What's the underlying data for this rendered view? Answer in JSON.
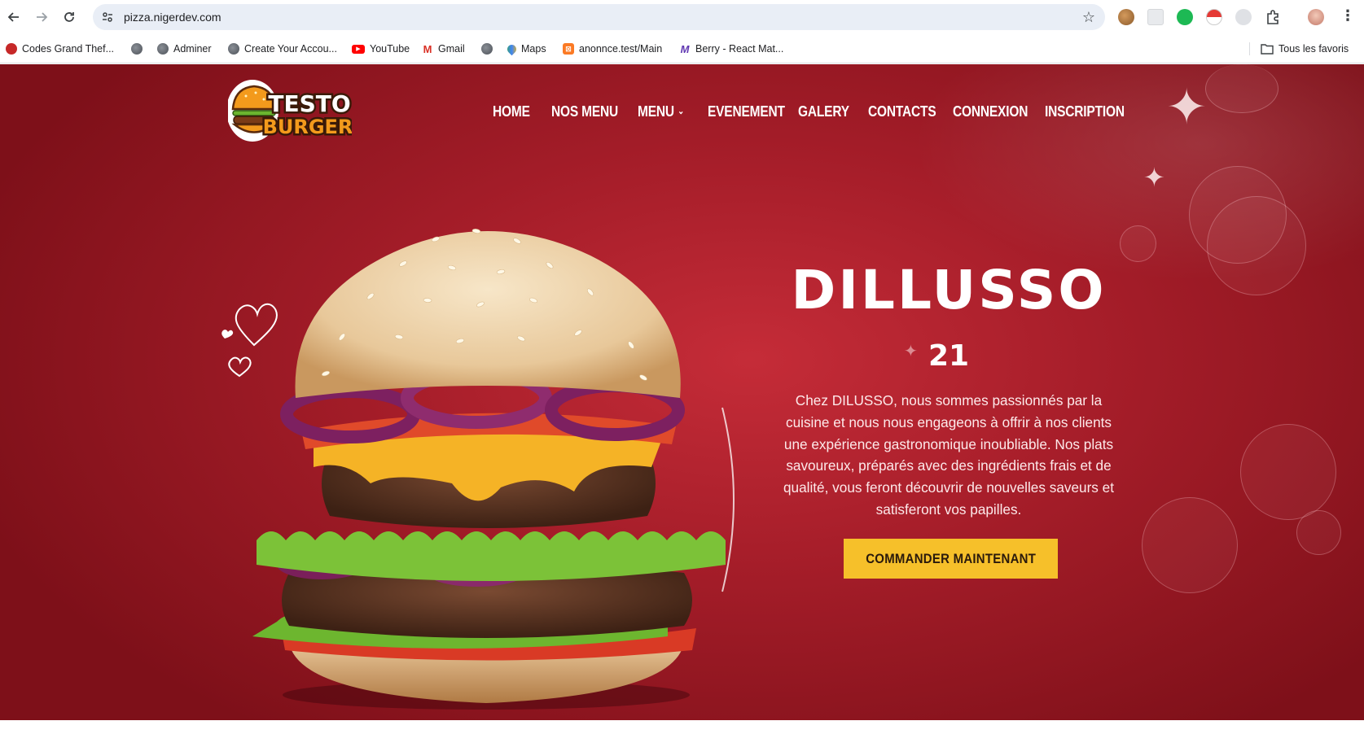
{
  "browser": {
    "url": "pizza.nigerdev.com",
    "bookmarks": [
      {
        "label": "Codes Grand Thef...",
        "icon": "gta-icon"
      },
      {
        "label": "",
        "icon": "globe-icon"
      },
      {
        "label": "Adminer",
        "icon": "globe-icon"
      },
      {
        "label": "Create Your Accou...",
        "icon": "globe-icon"
      },
      {
        "label": "YouTube",
        "icon": "youtube-icon"
      },
      {
        "label": "Gmail",
        "icon": "gmail-icon"
      },
      {
        "label": "",
        "icon": "globe-icon"
      },
      {
        "label": "Maps",
        "icon": "maps-icon"
      },
      {
        "label": "anonnce.test/Main",
        "icon": "xampp-icon"
      },
      {
        "label": "Berry - React Mat...",
        "icon": "berry-icon"
      }
    ],
    "all_bookmarks_label": "Tous les favoris"
  },
  "site": {
    "logo": {
      "line1": "TESTO",
      "line2": "BURGER"
    },
    "nav": [
      {
        "label": "HOME"
      },
      {
        "label": "NOS MENU"
      },
      {
        "label": "MENU",
        "dropdown": true
      },
      {
        "label": "EVENEMENT"
      },
      {
        "label": "GALERY"
      },
      {
        "label": "CONTACTS"
      },
      {
        "label": "CONNEXION"
      },
      {
        "label": "INSCRIPTION"
      }
    ],
    "hero": {
      "title": "DILLUSSO",
      "subtitle": "21",
      "description": "Chez DILUSSO, nous sommes passionnés par la cuisine et nous nous engageons à offrir à nos clients une expérience gastronomique inoubliable. Nos plats savoureux, préparés avec des ingrédients frais et de qualité, vous feront découvrir de nouvelles saveurs et satisferont vos papilles.",
      "cta": "COMMANDER MAINTENANT"
    }
  },
  "colors": {
    "hero_red": "#a51d29",
    "cta_yellow": "#f6c02a",
    "logo_orange": "#f39a1c"
  }
}
